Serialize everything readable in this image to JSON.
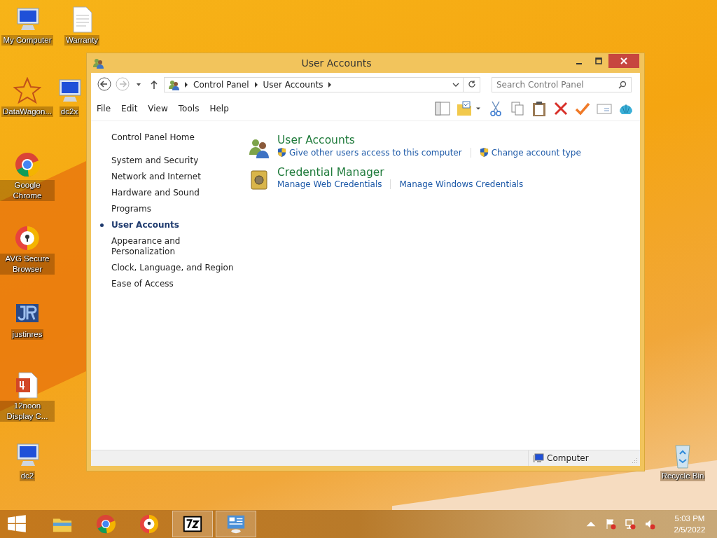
{
  "desktop_icons": [
    {
      "label": "My Computer",
      "kind": "monitor"
    },
    {
      "label": "Warranty",
      "kind": "document"
    },
    {
      "label": "DataWagon...",
      "kind": "star"
    },
    {
      "label": "dc2x",
      "kind": "monitor"
    },
    {
      "label": "Google Chrome",
      "kind": "chrome"
    },
    {
      "label": "AVG Secure Browser",
      "kind": "avg"
    },
    {
      "label": "justinres",
      "kind": "jr"
    },
    {
      "label": "12noon Display C...",
      "kind": "pdf"
    },
    {
      "label": "dc2",
      "kind": "monitor"
    },
    {
      "label": "Recycle Bin",
      "kind": "recycle"
    }
  ],
  "window": {
    "title": "User Accounts",
    "breadcrumb": [
      "Control Panel",
      "User Accounts"
    ],
    "search": {
      "placeholder": "Search Control Panel"
    },
    "menu": [
      "File",
      "Edit",
      "View",
      "Tools",
      "Help"
    ],
    "sidebar": {
      "home": "Control Panel Home",
      "items": [
        {
          "label": "System and Security",
          "selected": false
        },
        {
          "label": "Network and Internet",
          "selected": false
        },
        {
          "label": "Hardware and Sound",
          "selected": false
        },
        {
          "label": "Programs",
          "selected": false
        },
        {
          "label": "User Accounts",
          "selected": true
        },
        {
          "label": "Appearance and Personalization",
          "selected": false
        },
        {
          "label": "Clock, Language, and Region",
          "selected": false
        },
        {
          "label": "Ease of Access",
          "selected": false
        }
      ]
    },
    "sections": [
      {
        "title": "User Accounts",
        "kind": "users",
        "links": [
          {
            "label": "Give other users access to this computer",
            "shield": true
          },
          {
            "label": "Change account type",
            "shield": true
          }
        ]
      },
      {
        "title": "Credential Manager",
        "kind": "vault",
        "links": [
          {
            "label": "Manage Web Credentials",
            "shield": false
          },
          {
            "label": "Manage Windows Credentials",
            "shield": false
          }
        ]
      }
    ],
    "status_bar": "Computer"
  },
  "taskbar": {
    "apps": [
      {
        "kind": "folder",
        "running": false
      },
      {
        "kind": "chrome",
        "running": false
      },
      {
        "kind": "avg",
        "running": false
      },
      {
        "kind": "archiver",
        "running": true
      },
      {
        "kind": "control-panel",
        "running": true
      }
    ],
    "time": "5:03 PM",
    "date": "2/5/2022"
  }
}
